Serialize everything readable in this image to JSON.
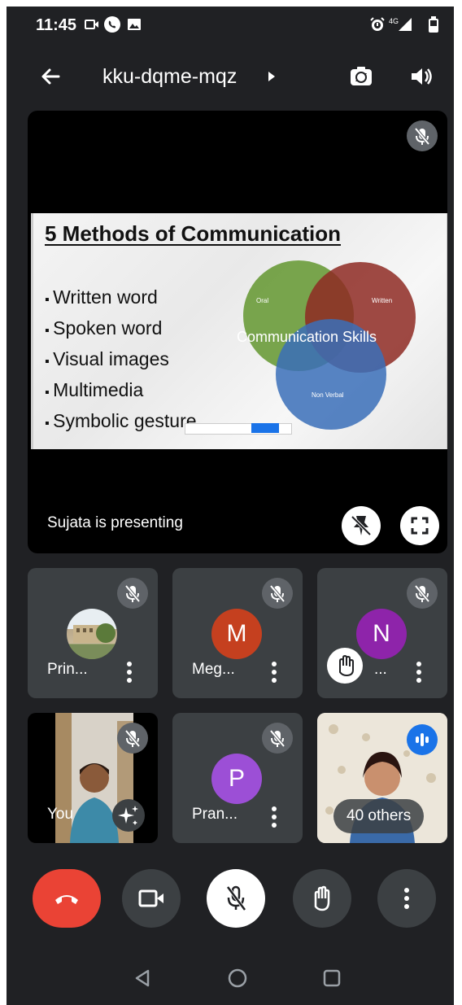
{
  "status_bar": {
    "time": "11:45",
    "network": "4G"
  },
  "meeting": {
    "code": "kku-dqme-mqz"
  },
  "presentation": {
    "slide": {
      "title": "5 Methods of Communication",
      "bullets": [
        "Written word",
        "Spoken word",
        "Visual images",
        "Multimedia",
        "Symbolic gesture"
      ],
      "venn": {
        "center_label": "Communication Skills",
        "labels": [
          "Oral",
          "Written",
          "Non Verbal"
        ]
      }
    },
    "presenter_label": "Sujata is presenting"
  },
  "participants": [
    {
      "name": "Prin...",
      "avatar": "photo",
      "muted": true
    },
    {
      "name": "Meg...",
      "initial": "M",
      "color": "#c5401f",
      "muted": true
    },
    {
      "name": "...",
      "initial": "N",
      "color": "#8e24aa",
      "muted": true,
      "hand_raised": true
    },
    {
      "name": "You",
      "avatar": "video",
      "muted": true
    },
    {
      "name": "Pran...",
      "initial": "P",
      "color": "#9c4fd6",
      "muted": true
    },
    {
      "name": "40 others",
      "avatar": "video",
      "speaking": true
    }
  ],
  "colors": {
    "end_call": "#ea4335",
    "background": "#202124",
    "tile": "#3c4043",
    "button": "#3c4043"
  }
}
